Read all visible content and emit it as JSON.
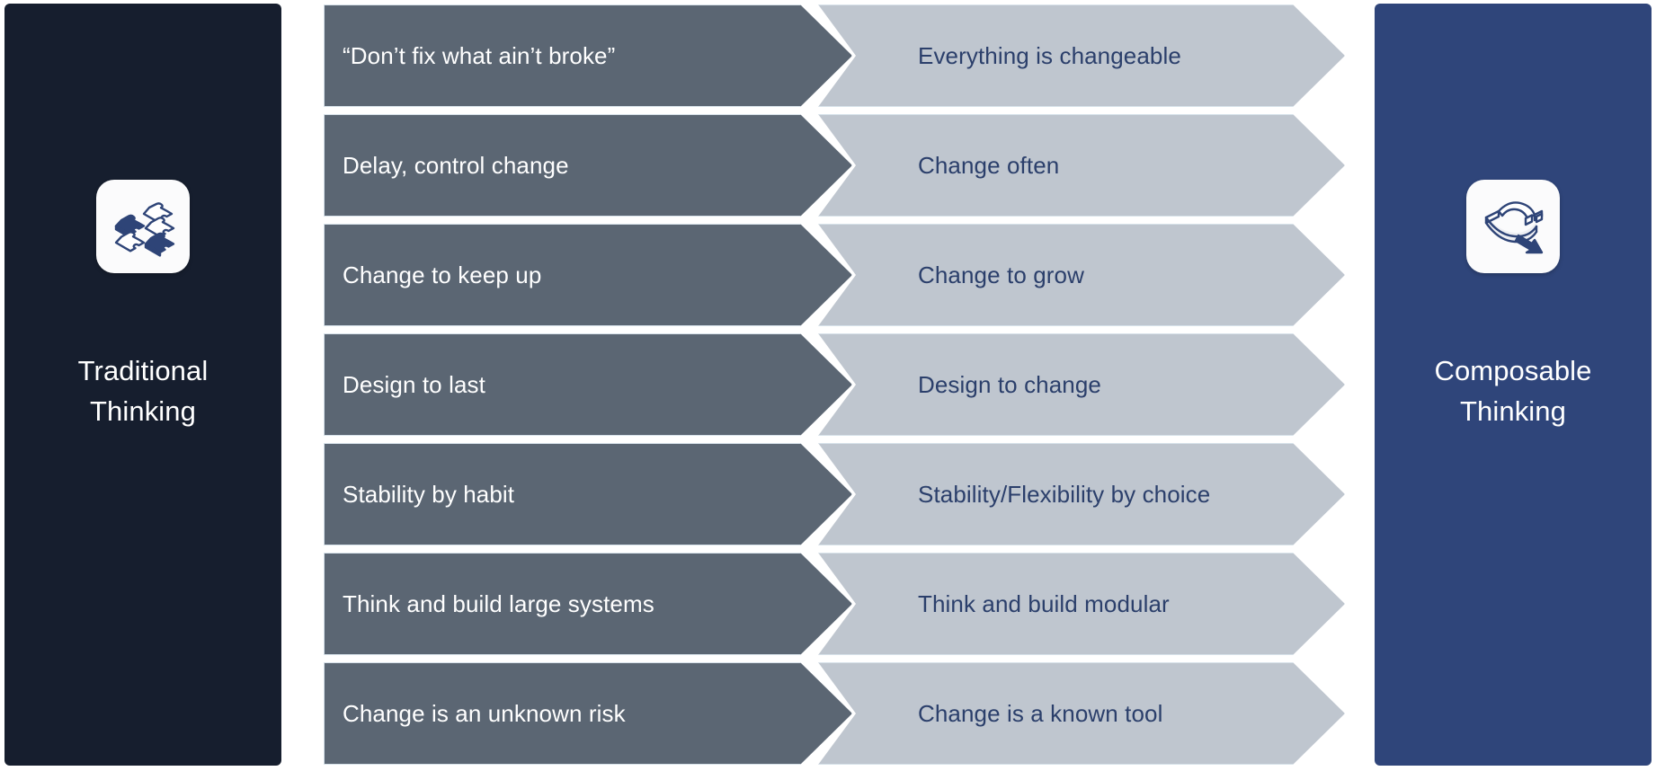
{
  "left_panel": {
    "title": "Traditional\nThinking",
    "icon": "puzzle-pieces-icon",
    "background_color": "#161E2E",
    "text_color": "#FFFFFF"
  },
  "right_panel": {
    "title": "Composable\nThinking",
    "icon": "flexible-arrow-icon",
    "background_color": "#2F457A",
    "text_color": "#FFFFFF"
  },
  "colors": {
    "traditional_chevron": "#5B6673",
    "composable_chevron": "#BFC6CF",
    "traditional_chevron_text": "#FFFFFF",
    "composable_chevron_text": "#2B3F6B",
    "chevron_outline": "#D7E2EA",
    "page_background": "#FFFFFF"
  },
  "rows": [
    {
      "traditional": "“Don’t fix what ain’t broke”",
      "composable": "Everything is changeable"
    },
    {
      "traditional": "Delay, control change",
      "composable": "Change often"
    },
    {
      "traditional": "Change to keep up",
      "composable": "Change to grow"
    },
    {
      "traditional": "Design to last",
      "composable": "Design to change"
    },
    {
      "traditional": "Stability by habit",
      "composable": "Stability/Flexibility by choice"
    },
    {
      "traditional": "Think and build large systems",
      "composable": "Think and build modular"
    },
    {
      "traditional": "Change is an unknown risk",
      "composable": "Change is a known tool"
    }
  ]
}
